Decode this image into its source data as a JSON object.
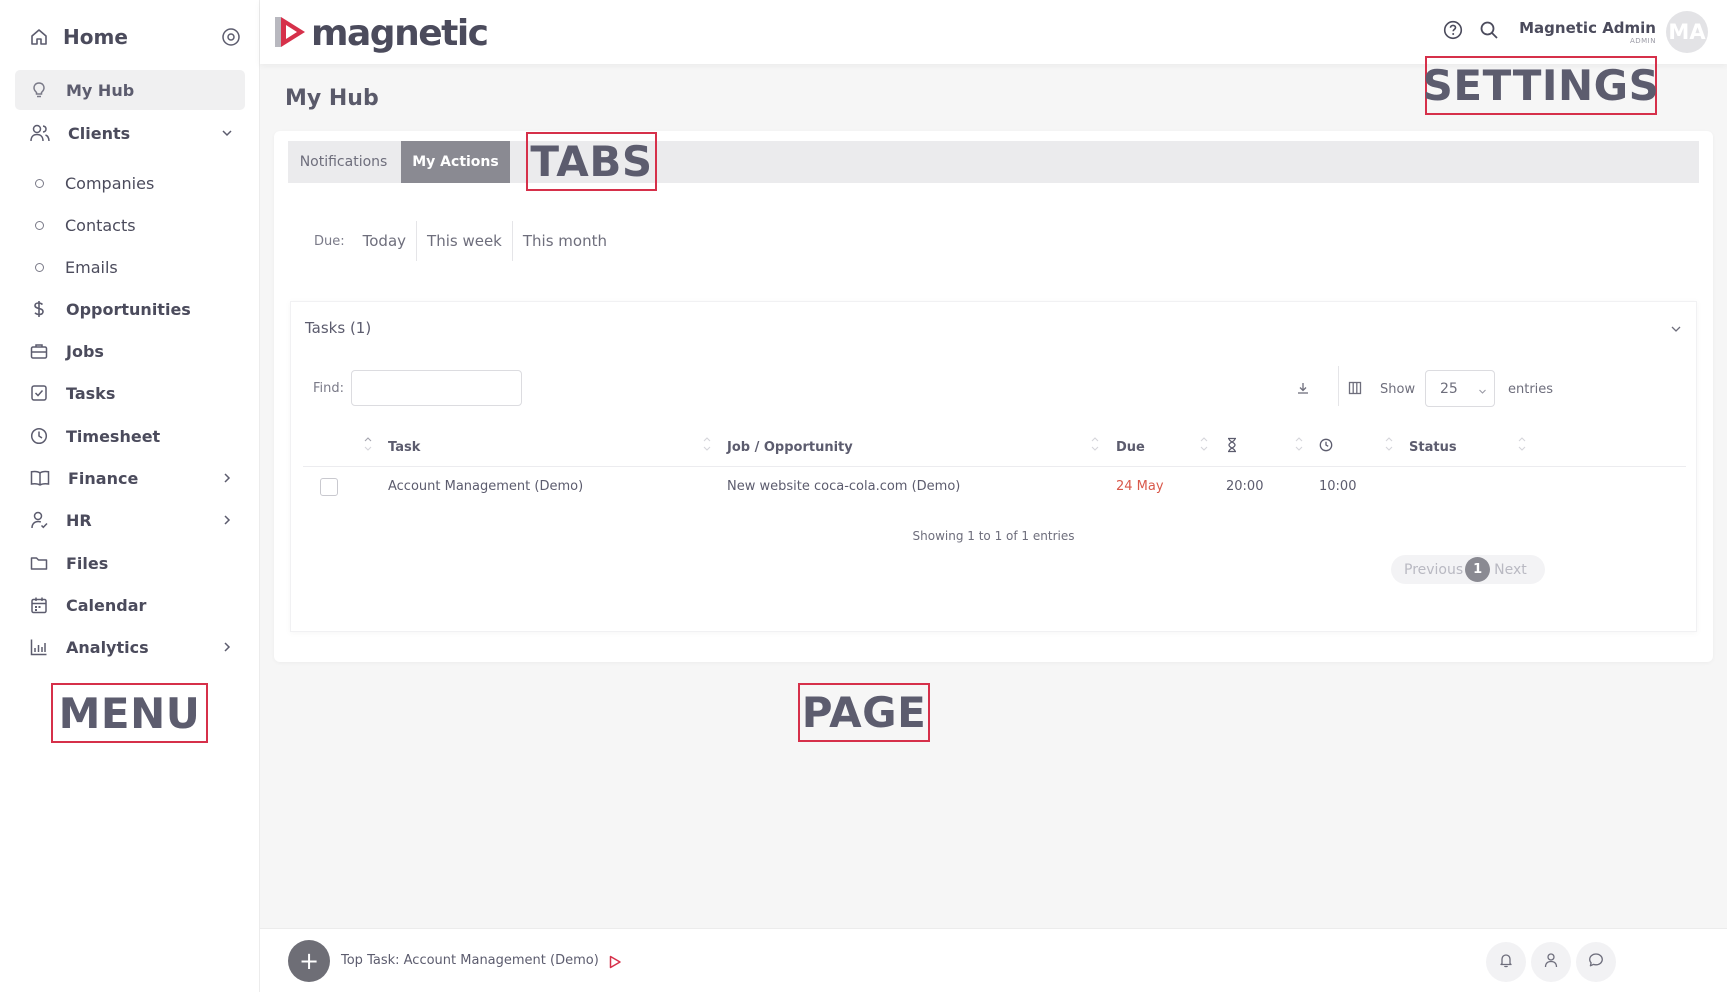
{
  "sidebar": {
    "home_label": "Home",
    "items": [
      {
        "label": "My Hub"
      },
      {
        "label": "Clients"
      },
      {
        "label": "Companies"
      },
      {
        "label": "Contacts"
      },
      {
        "label": "Emails"
      },
      {
        "label": "Opportunities"
      },
      {
        "label": "Jobs"
      },
      {
        "label": "Tasks"
      },
      {
        "label": "Timesheet"
      },
      {
        "label": "Finance"
      },
      {
        "label": "HR"
      },
      {
        "label": "Files"
      },
      {
        "label": "Calendar"
      },
      {
        "label": "Analytics"
      }
    ]
  },
  "header": {
    "logo_text": "magnetic",
    "user_name": "Magnetic Admin",
    "user_role": "ADMIN",
    "avatar_initials": "MA",
    "icons": [
      "help-icon",
      "search-icon"
    ]
  },
  "page": {
    "title": "My Hub",
    "tabs": [
      {
        "label": "Notifications",
        "active": false
      },
      {
        "label": "My Actions",
        "active": true
      }
    ],
    "due_filter": {
      "label": "Due:",
      "options": [
        "Today",
        "This week",
        "This month"
      ]
    }
  },
  "tasks": {
    "title": "Tasks (1)",
    "find_label": "Find:",
    "find_value": "",
    "show_label": "Show",
    "show_value": "25",
    "entries_label": "entries",
    "columns": [
      "Task",
      "Job / Opportunity",
      "Due",
      "hourglass-icon",
      "clock-icon",
      "Status"
    ],
    "rows": [
      {
        "task": "Account Management (Demo)",
        "job": "New website coca-cola.com (Demo)",
        "due": "24 May",
        "estimate": "20:00",
        "time": "10:00",
        "status": ""
      }
    ],
    "showing_text": "Showing 1 to 1 of 1 entries",
    "pager": {
      "previous": "Previous",
      "current": "1",
      "next": "Next"
    }
  },
  "annotations": {
    "settings": "SETTINGS",
    "tabs": "TABS",
    "menu": "MENU",
    "page": "PAGE"
  },
  "bottombar": {
    "add_label": "+",
    "top_task": "Top Task: Account Management (Demo)",
    "icons": [
      "bell-icon",
      "person-icon",
      "chat-icon"
    ]
  },
  "colors": {
    "accent_red": "#d6304a",
    "due_overdue": "#d9594b",
    "active_tab": "#8a8a92",
    "text_primary": "#4b4b5c"
  }
}
